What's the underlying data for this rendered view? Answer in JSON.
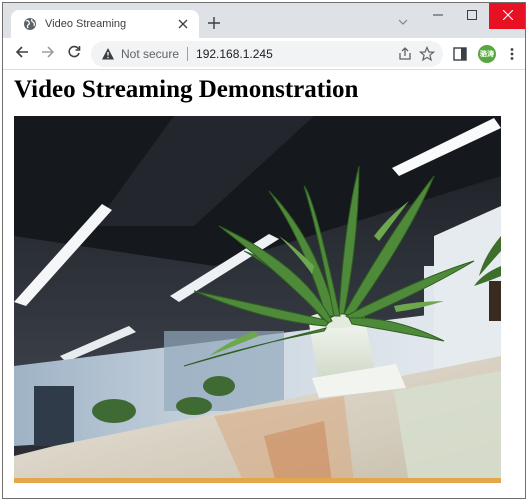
{
  "browser": {
    "tab": {
      "title": "Video Streaming",
      "favicon": "globe-icon",
      "close_icon": "close-icon"
    },
    "new_tab_icon": "plus-icon",
    "tab_search_icon": "chevron-down-icon",
    "window_controls": {
      "minimize_icon": "minimize-icon",
      "maximize_icon": "maximize-icon",
      "close_icon": "close-icon",
      "close_color": "#e81123"
    },
    "toolbar": {
      "back_icon": "arrow-left-icon",
      "forward_icon": "arrow-right-icon",
      "reload_icon": "reload-icon",
      "security_icon": "warning-triangle-icon",
      "security_text": "Not secure",
      "url": "192.168.1.245",
      "share_icon": "share-icon",
      "bookmark_icon": "star-icon",
      "side_panel_icon": "side-panel-icon",
      "profile_initials": "骆涛",
      "profile_color": "#56a83e",
      "menu_icon": "kebab-menu-icon"
    }
  },
  "page": {
    "heading": "Video Streaming Demonstration",
    "video": {
      "description_icon": "video-stream"
    }
  },
  "colors": {
    "tabstrip_bg": "#dee1e6",
    "omnibox_bg": "#f1f3f4",
    "text_secondary": "#5f6368"
  }
}
